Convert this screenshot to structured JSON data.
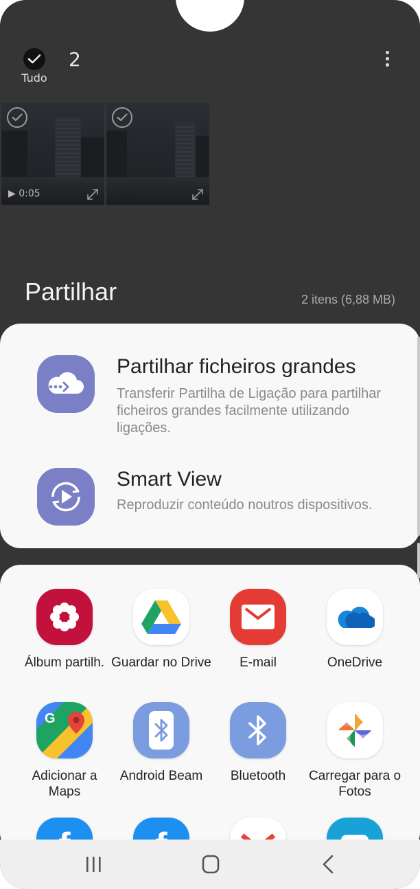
{
  "top_bar": {
    "select_all_label": "Tudo",
    "selected_count": "2"
  },
  "thumbnails": [
    {
      "duration": "0:05",
      "type": "video"
    },
    {
      "duration": "",
      "type": "image"
    }
  ],
  "share": {
    "title": "Partilhar",
    "summary": "2 itens (6,88 MB)"
  },
  "options": [
    {
      "title": "Partilhar ficheiros grandes",
      "description": "Transferir Partilha de Ligação para partilhar ficheiros grandes facilmente utilizando ligações.",
      "icon": "cloud-link-icon"
    },
    {
      "title": "Smart View",
      "description": "Reproduzir conteúdo noutros dispositivos.",
      "icon": "smart-view-icon"
    }
  ],
  "apps": [
    {
      "label": "Álbum partilh.",
      "icon": "flower-icon",
      "color": "#c2113c"
    },
    {
      "label": "Guardar no Drive",
      "icon": "google-drive-icon",
      "color": "#ffffff"
    },
    {
      "label": "E-mail",
      "icon": "envelope-icon",
      "color": "#e43c34"
    },
    {
      "label": "OneDrive",
      "icon": "onedrive-cloud-icon",
      "color": "#ffffff"
    },
    {
      "label": "Adicionar a Maps",
      "icon": "google-maps-icon",
      "color": "#ffffff"
    },
    {
      "label": "Android Beam",
      "icon": "android-beam-icon",
      "color": "#7b9cdf"
    },
    {
      "label": "Bluetooth",
      "icon": "bluetooth-icon",
      "color": "#7b9cdf"
    },
    {
      "label": "Carregar para o Fotos",
      "icon": "google-photos-icon",
      "color": "#ffffff"
    },
    {
      "label": "",
      "icon": "facebook-icon",
      "color": "#1d8ff0"
    },
    {
      "label": "",
      "icon": "facebook-icon",
      "color": "#1d8ff0"
    },
    {
      "label": "",
      "icon": "gmail-icon",
      "color": "#ffffff"
    },
    {
      "label": "",
      "icon": "message-icon",
      "color": "#19a2d8"
    }
  ],
  "colors": {
    "background": "#353535",
    "card": "#f8f8f8",
    "accent_purple": "#7b7fc6"
  }
}
